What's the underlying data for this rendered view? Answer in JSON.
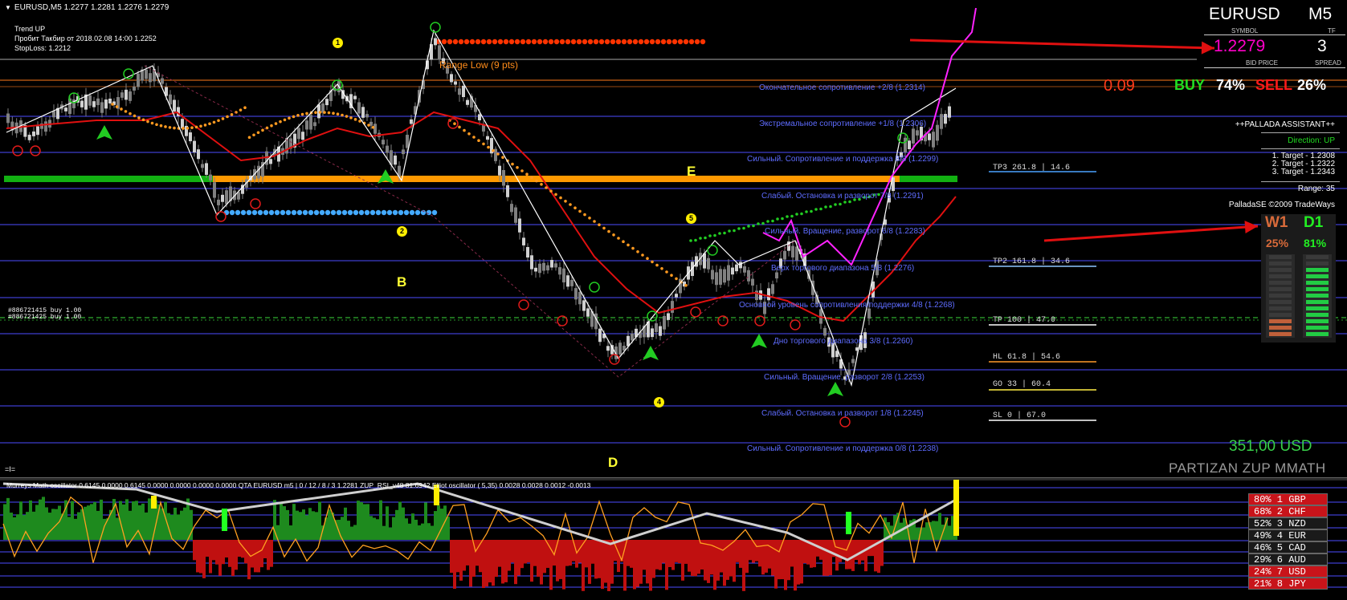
{
  "header": {
    "symbol_line": "EURUSD,M5  1.2277 1.2281 1.2276 1.2279",
    "trend_lines": [
      "Trend UP",
      "Пробит Такбир от 2018.02.08 14:00 1.2252",
      "StopLoss: 1.2212"
    ]
  },
  "info_panel": {
    "symbol": "EURUSD",
    "symbol_caption": "SYMBOL",
    "timeframe": "M5",
    "timeframe_caption": "TF",
    "bid": "1.2279",
    "bid_caption": "BID PRICE",
    "spread": "3",
    "spread_caption": "SPREAD",
    "red_value": "0.09",
    "buy_label": "BUY",
    "buy_pct": "74%",
    "sell_label": "SELL",
    "sell_pct": "26%"
  },
  "assistant": {
    "title": "++PALLADA ASSISTANT++",
    "direction": "Direction: UP",
    "targets": [
      "1. Target - 1.2308",
      "2. Target - 1.2322",
      "3. Target - 1.2343"
    ],
    "range": "Range: 35",
    "copyright": "PalladaSE ©2009 TradeWays"
  },
  "wd_panel": {
    "w_label": "W1",
    "w_pct": "25%",
    "w_fill": 0.25,
    "d_label": "D1",
    "d_pct": "81%",
    "d_fill": 0.81
  },
  "balance": "351,00 USD",
  "brand": "PARTIZAN ZUP MMATH",
  "range_label": "Range Low (9 pts)",
  "position_labels": [
    "#886721415 buy 1.00",
    "#886721425 buy 1.00"
  ],
  "eq_mark": "=I=",
  "wave_letters": [
    "B",
    "E",
    "D"
  ],
  "wave_numbers": [
    "1",
    "2",
    "4",
    "5"
  ],
  "murrey_levels": [
    {
      "text": "Окончательное сопротивление +2/8  (1.2314)",
      "color": "#ff7a1a"
    },
    {
      "text": "Экстремальное сопротивление +1/8  (1.2306)",
      "color": "#5e6cff"
    },
    {
      "text": "Сильный. Сопротивление и поддержка 8/8  (1.2299)",
      "color": "#5e6cff"
    },
    {
      "text": "Слабый. Остановка и разворот 7/8  (1.2291)",
      "color": "#5e6cff"
    },
    {
      "text": "Сильный. Вращение, разворот 6/8  (1.2283)",
      "color": "#5e6cff"
    },
    {
      "text": "Верх торгового диапазона 5/8  (1.2276)",
      "color": "#5e6cff"
    },
    {
      "text": "Основной уровень сопротивления/поддержки 4/8  (1.2268)",
      "color": "#5e6cff"
    },
    {
      "text": "Дно торгового диапазона 3/8  (1.2260)",
      "color": "#5e6cff"
    },
    {
      "text": "Сильный. Вращение, разворот 2/8  (1.2253)",
      "color": "#5e6cff"
    },
    {
      "text": "Слабый. Остановка и разворот 1/8  (1.2245)",
      "color": "#5e6cff"
    },
    {
      "text": "Сильный. Сопротивление и поддержка 0/8  (1.2238)",
      "color": "#5e6cff"
    }
  ],
  "fib_levels": [
    {
      "text": "TP3  261.8   |  14.6",
      "color": "#4aa3ff"
    },
    {
      "text": "TP2  161.8   |  34.6",
      "color": "#8ec5ff"
    },
    {
      "text": "TP   100     |  47.0",
      "color": "#ffffff"
    },
    {
      "text": "HL   61.8    |  54.6",
      "color": "#ff9a2a"
    },
    {
      "text": "GO   33      |  60.4",
      "color": "#ffee44"
    },
    {
      "text": "SL   0       |  67.0",
      "color": "#ffffff"
    }
  ],
  "oscillator": {
    "title": "Murreys Math oscillator 0.6145 0.0000 0.6145 0.0000 0.0000 0.0000 0.0000  QTA EURUSD m5 | 0 / 12 / 8 / 3 1.2281  ZUP_RSI_v48 81.6942  Elliot oscillator ( 5,35) 0.0028 0.0028 0.0012 -0.0013"
  },
  "currency_strength": [
    {
      "text": "80%  1  GBP",
      "bg": "#c8141a",
      "fg": "#ffffff"
    },
    {
      "text": "68%  2  CHF",
      "bg": "#c8141a",
      "fg": "#ffffff"
    },
    {
      "text": "52%  3  NZD",
      "bg": "#1a1a1a",
      "fg": "#ffffff"
    },
    {
      "text": "49%  4  EUR",
      "bg": "#1a1a1a",
      "fg": "#ffffff"
    },
    {
      "text": "46%  5  CAD",
      "bg": "#1a1a1a",
      "fg": "#ffffff"
    },
    {
      "text": "29%  6  AUD",
      "bg": "#1a1a1a",
      "fg": "#ffffff"
    },
    {
      "text": "24%  7  USD",
      "bg": "#c8141a",
      "fg": "#ffffff"
    },
    {
      "text": "21%  8  JPY",
      "bg": "#c8141a",
      "fg": "#ffffff"
    }
  ],
  "colors": {
    "murrey_line": "#4c4cff",
    "bull_candle": "#d0d0d0",
    "bear_candle": "#808080",
    "ma_red": "#e01010",
    "zigzag": "#ffffff",
    "magenta": "#ff22ff",
    "green_bar": "#12b012",
    "orange_bar": "#ff9900",
    "blue_dots": "#44aaff",
    "red_dots": "#ff3300",
    "osc_green": "#1e8a1e",
    "osc_red": "#c01010",
    "osc_orange": "#ffa020",
    "osc_gray": "#cfcfcf",
    "annotation_arrow": "#e01010"
  }
}
